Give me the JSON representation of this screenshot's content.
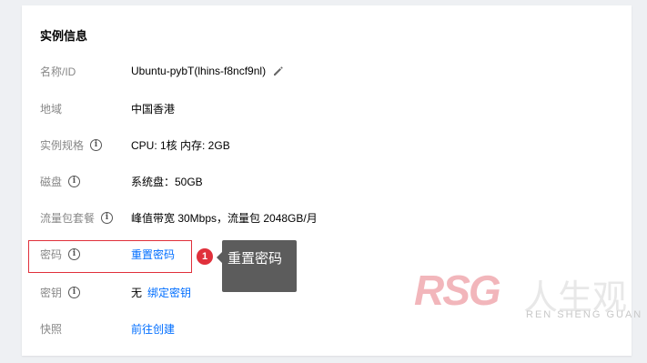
{
  "card": {
    "title": "实例信息",
    "rows": [
      {
        "label": "名称/ID",
        "value": "Ubuntu-pybT(lhins-f8ncf9nl)"
      },
      {
        "label": "地域",
        "value": "中国香港"
      },
      {
        "label": "实例规格",
        "value": "CPU: 1核 内存: 2GB"
      },
      {
        "label": "磁盘",
        "value": "系统盘：50GB"
      },
      {
        "label": "流量包套餐",
        "value": "峰值带宽 30Mbps，流量包 2048GB/月"
      },
      {
        "label": "密码",
        "link": "重置密码"
      },
      {
        "label": "密钥",
        "value": "无",
        "link": "绑定密钥"
      },
      {
        "label": "快照",
        "link": "前往创建"
      }
    ]
  },
  "annotation": {
    "step_number": "1",
    "tooltip_text": "重置密码",
    "highlight_color": "#e0303b"
  },
  "watermark": {
    "logo": "RSG",
    "chinese": "人生观",
    "sub": "REN SHENG GUAN"
  },
  "colors": {
    "link": "#006eff",
    "label": "#888888",
    "tooltip_bg": "#5c5c5c"
  }
}
